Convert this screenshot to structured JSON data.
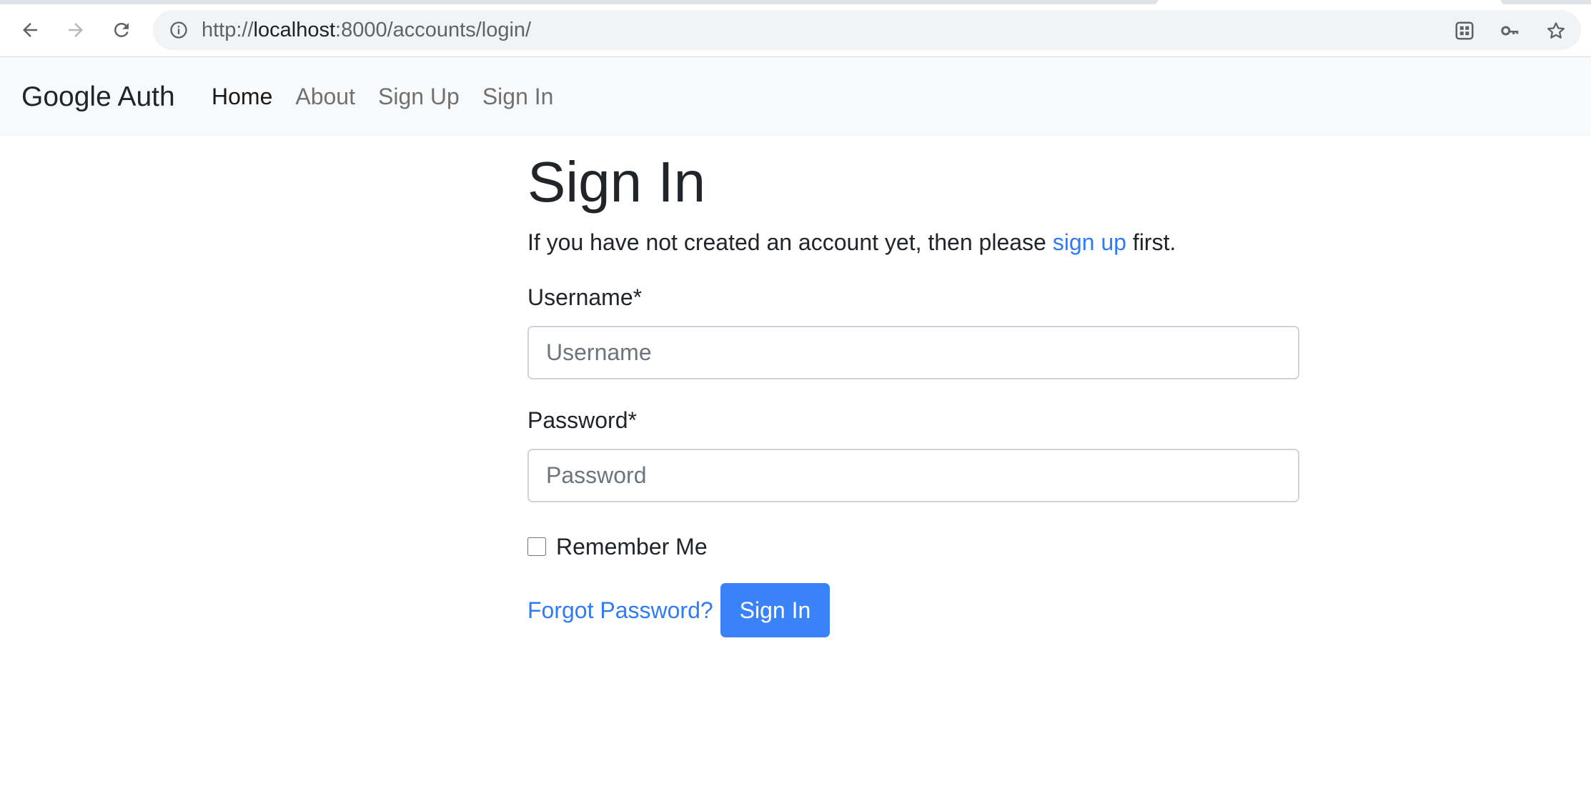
{
  "browser": {
    "url_scheme": "http://",
    "url_host": "localhost",
    "url_rest": ":8000/accounts/login/"
  },
  "navbar": {
    "brand": "Google Auth",
    "links": [
      {
        "label": "Home",
        "active": true
      },
      {
        "label": "About",
        "active": false
      },
      {
        "label": "Sign Up",
        "active": false
      },
      {
        "label": "Sign In",
        "active": false
      }
    ]
  },
  "main": {
    "title": "Sign In",
    "intro_before": "If you have not created an account yet, then please ",
    "intro_link": "sign up",
    "intro_after": " first.",
    "username_label": "Username*",
    "username_placeholder": "Username",
    "username_value": "",
    "password_label": "Password*",
    "password_placeholder": "Password",
    "password_value": "",
    "remember_label": "Remember Me",
    "remember_checked": false,
    "forgot_link": "Forgot Password?",
    "submit_label": "Sign In"
  },
  "colors": {
    "link": "#2e7cf6",
    "primary_button": "#3a82f7",
    "navbar_bg": "#f8f9fa"
  },
  "icons": {
    "back": "arrow-left-icon",
    "forward": "arrow-right-icon",
    "reload": "reload-icon",
    "site_info": "info-icon",
    "apps": "apps-grid-icon",
    "passwords": "key-icon",
    "bookmark": "star-icon"
  }
}
